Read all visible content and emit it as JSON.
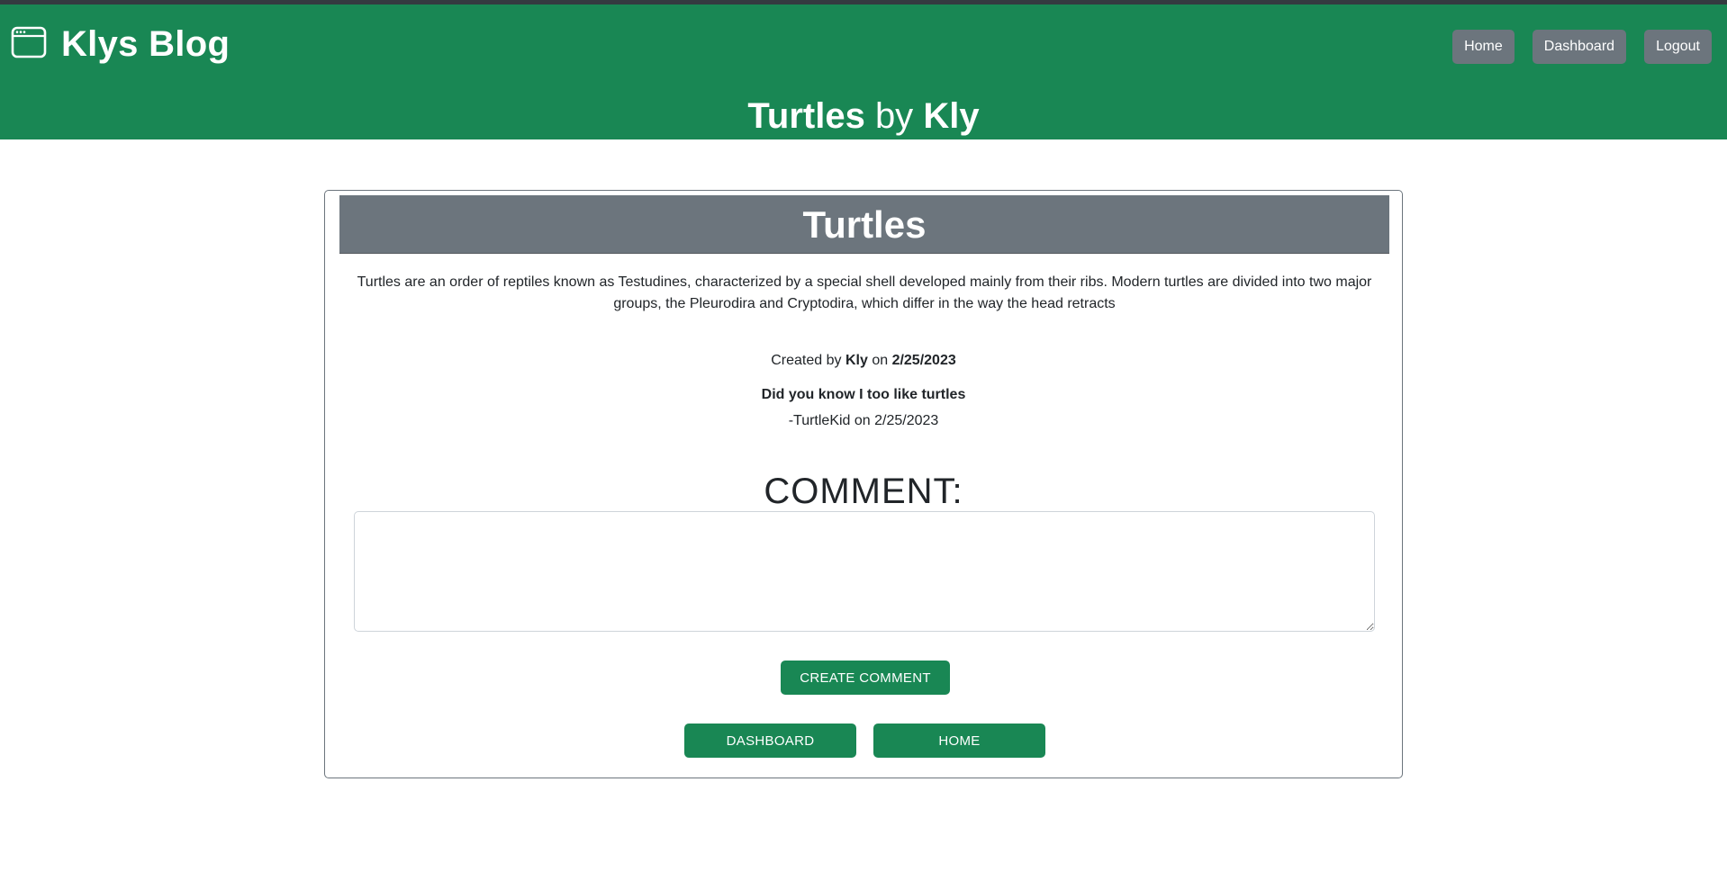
{
  "header": {
    "brand_title": "Klys Blog",
    "brand_icon": "browser-window-icon",
    "page_title_post": "Turtles",
    "page_title_by": "by",
    "page_title_author": "Kly",
    "nav": [
      {
        "label": "Home"
      },
      {
        "label": "Dashboard"
      },
      {
        "label": "Logout"
      }
    ]
  },
  "post": {
    "title": "Turtles",
    "body": "Turtles are an order of reptiles known as Testudines, characterized by a special shell developed mainly from their ribs. Modern turtles are divided into two major groups, the Pleurodira and Cryptodira, which differ in the way the head retracts",
    "meta_prefix": "Created by",
    "author": "Kly",
    "meta_on": "on",
    "date": "2/25/2023"
  },
  "comments": [
    {
      "text": "Did you know I too like turtles",
      "byline": "-TurtleKid on 2/25/2023"
    }
  ],
  "comment_form": {
    "heading": "COMMENT:",
    "textarea_value": "",
    "submit_label": "CREATE COMMENT"
  },
  "footer_buttons": {
    "dashboard_label": "DASHBOARD",
    "home_label": "HOME"
  },
  "colors": {
    "header_green": "#198754",
    "button_gray": "#6c757d",
    "top_bar": "#343a40"
  }
}
